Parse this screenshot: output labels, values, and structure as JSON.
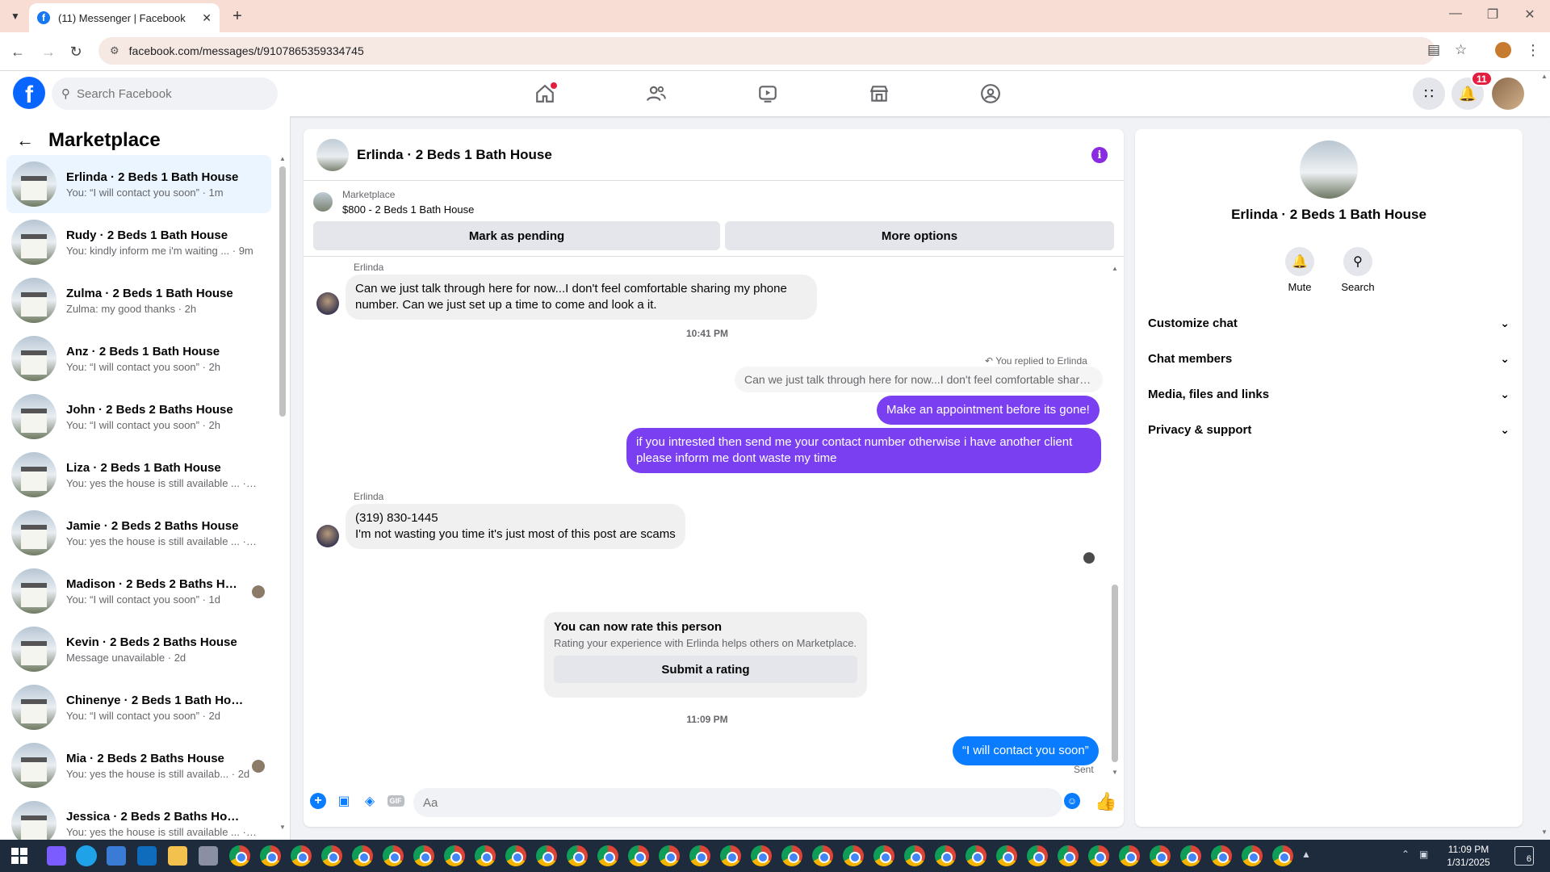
{
  "browser": {
    "tab_title": "(11) Messenger | Facebook",
    "url": "facebook.com/messages/t/9107865359334745"
  },
  "fb_header": {
    "search_placeholder": "Search Facebook",
    "notification_count": "11"
  },
  "sidebar": {
    "title": "Marketplace",
    "conversations": [
      {
        "name": "Erlinda · 2 Beds 1 Bath House",
        "preview": "You: “I will contact you soon” · 1m"
      },
      {
        "name": "Rudy · 2 Beds 1 Bath House",
        "preview": "You: kindly inform me i'm waiting ... · 9m"
      },
      {
        "name": "Zulma · 2 Beds 1 Bath House",
        "preview": "Zulma: my good thanks · 2h"
      },
      {
        "name": "Anz · 2 Beds 1 Bath House",
        "preview": "You: “I will contact you soon” · 2h"
      },
      {
        "name": "John · 2 Beds 2 Baths House",
        "preview": "You: “I will contact you soon” · 2h"
      },
      {
        "name": "Liza · 2 Beds 1 Bath House",
        "preview": "You: yes the house is still available ... · 4h"
      },
      {
        "name": "Jamie · 2 Beds 2 Baths House",
        "preview": "You: yes the house is still available ... · 4h"
      },
      {
        "name": "Madison · 2 Beds 2 Baths Hou...",
        "preview": "You: “I will contact you soon” · 1d"
      },
      {
        "name": "Kevin · 2 Beds 2 Baths House",
        "preview": "Message unavailable · 2d"
      },
      {
        "name": "Chinenye · 2 Beds 1 Bath House",
        "preview": "You: “I will contact you soon” · 2d"
      },
      {
        "name": "Mia · 2 Beds 2 Baths House",
        "preview": "You: yes the house is still availab... · 2d"
      },
      {
        "name": "Jessica · 2 Beds 2 Baths House",
        "preview": "You: yes the house is still available ... · 2d"
      }
    ]
  },
  "chat": {
    "title": "Erlinda · 2 Beds 1 Bath House",
    "marketplace_label": "Marketplace",
    "listing": "$800 - 2 Beds 1 Bath House",
    "mark_pending": "Mark as pending",
    "more_options": "More options",
    "sender_1": "Erlinda",
    "msg_1": "Can we just talk through here for now...I don't feel comfortable sharing my phone number. Can we just set up a time to come and look a it.",
    "time_1": "10:41 PM",
    "reply_note": "You replied to Erlinda",
    "reply_quote": "Can we just talk through here for now...I don't feel comfortable sharing m...",
    "out_1": "Make an appointment before its gone!",
    "out_2": "if you intrested then send me your contact number otherwise i have another client please inform me dont waste my time",
    "sender_2": "Erlinda",
    "msg_2_line1": "(319) 830-1445",
    "msg_2_line2": "I'm not wasting you time it's just most of this post are scams",
    "rate_title": "You can now rate this person",
    "rate_sub": "Rating your experience with Erlinda helps others on Marketplace.",
    "rate_button": "Submit a rating",
    "time_2": "11:09 PM",
    "out_3": "“I will contact you soon”",
    "sent": "Sent",
    "composer_placeholder": "Aa"
  },
  "info_panel": {
    "name": "Erlinda · 2 Beds 1 Bath House",
    "mute": "Mute",
    "search": "Search",
    "sections": [
      "Customize chat",
      "Chat members",
      "Media, files and links",
      "Privacy & support"
    ]
  },
  "taskbar": {
    "time": "11:09 PM",
    "date": "1/31/2025",
    "notif_count": "6"
  },
  "colors": {
    "accent_purple": "#7b3ff2",
    "messenger_blue": "#0a7cff",
    "fb_blue": "#0866ff",
    "badge_red": "#e41e3f"
  }
}
